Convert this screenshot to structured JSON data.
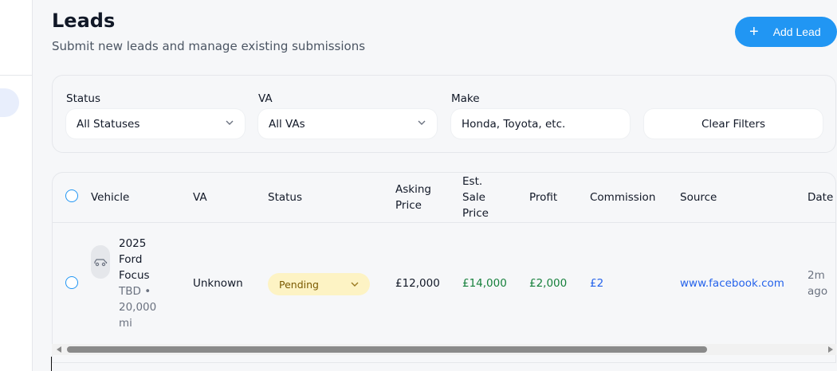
{
  "page": {
    "title": "Leads",
    "subtitle": "Submit new leads and manage existing submissions",
    "add_button": "Add Lead",
    "add_icon": "+"
  },
  "filters": {
    "status_label": "Status",
    "status_value": "All Statuses",
    "va_label": "VA",
    "va_value": "All VAs",
    "make_label": "Make",
    "make_placeholder": "Honda, Toyota, etc.",
    "clear_button": "Clear Filters"
  },
  "table": {
    "columns": {
      "vehicle": "Vehicle",
      "va": "VA",
      "status": "Status",
      "asking_price_1": "Asking",
      "asking_price_2": "Price",
      "est_1": "Est.",
      "est_2": "Sale",
      "est_3": "Price",
      "profit": "Profit",
      "commission": "Commission",
      "source": "Source",
      "date": "Date"
    },
    "rows": [
      {
        "vehicle_line1": "2025",
        "vehicle_line2": "Ford",
        "vehicle_line3": "Focus",
        "meta_line1": "TBD •",
        "meta_line2": "20,000",
        "meta_line3": "mi",
        "va": "Unknown",
        "status": "Pending",
        "asking_price": "£12,000",
        "est_sale_price": "£14,000",
        "profit": "£2,000",
        "commission": "£2",
        "source": "www.facebook.com",
        "date_line1": "2m",
        "date_line2": "ago"
      }
    ]
  },
  "colors": {
    "accent": "#2196f3",
    "green": "#16803c",
    "link": "#2563eb",
    "pending_bg": "#fdf3c4"
  },
  "icons": {
    "car": "car-icon",
    "chevron": "chevron-down-icon",
    "plus": "plus-icon"
  }
}
